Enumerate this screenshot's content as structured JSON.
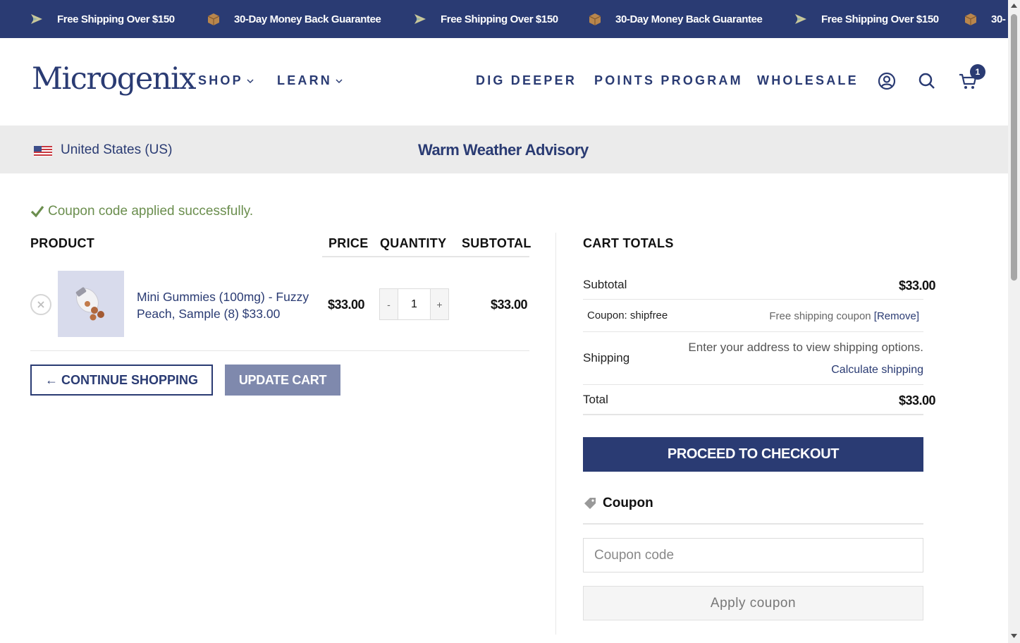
{
  "announcement": {
    "items": [
      {
        "icon": "shipping-plane-icon",
        "text": "Free Shipping Over $150"
      },
      {
        "icon": "box-icon",
        "text": "30-Day Money Back Guarantee"
      },
      {
        "icon": "shipping-plane-icon",
        "text": "Free Shipping Over $150"
      },
      {
        "icon": "box-icon",
        "text": "30-Day Money Back Guarantee"
      },
      {
        "icon": "shipping-plane-icon",
        "text": "Free Shipping Over $150"
      },
      {
        "icon": "box-icon",
        "text": "30-"
      }
    ],
    "bg_color": "#2a3b73"
  },
  "header": {
    "logo": "Microgenix",
    "nav": {
      "shop": "SHOP",
      "learn": "LEARN",
      "dig_deeper": "DIG DEEPER",
      "points": "POINTS PROGRAM",
      "wholesale": "WHOLESALE"
    },
    "icons": [
      "account-icon",
      "search-icon",
      "cart-icon"
    ],
    "cart_count": "1"
  },
  "strip": {
    "country": "United States (US)",
    "advisory": "Warm Weather Advisory"
  },
  "notice": "Coupon code applied successfully.",
  "cart": {
    "headers": {
      "product": "PRODUCT",
      "price": "PRICE",
      "quantity": "QUANTITY",
      "subtotal": "SUBTOTAL"
    },
    "items": [
      {
        "name": "Mini Gummies (100mg) - Fuzzy Peach, Sample (8) $33.00",
        "price": "$33.00",
        "quantity": "1",
        "subtotal": "$33.00",
        "qty_minus": "-",
        "qty_plus": "+"
      }
    ],
    "continue_label": "← CONTINUE SHOPPING",
    "update_label": "UPDATE CART"
  },
  "totals": {
    "title": "CART TOTALS",
    "subtotal_label": "Subtotal",
    "subtotal_value": "$33.00",
    "coupon_label": "Coupon: shipfree",
    "coupon_desc": "Free shipping coupon ",
    "coupon_remove": "[Remove]",
    "shipping_label": "Shipping",
    "shipping_note": "Enter your address to view shipping options.",
    "calc_shipping": "Calculate shipping",
    "total_label": "Total",
    "total_value": "$33.00",
    "checkout_label": "PROCEED TO CHECKOUT"
  },
  "coupon": {
    "heading": "Coupon",
    "placeholder": "Coupon code",
    "apply_label": "Apply coupon"
  },
  "colors": {
    "brand_navy": "#2a3b73",
    "success_green": "#6b8e4e",
    "update_button": "#7f89ad"
  }
}
